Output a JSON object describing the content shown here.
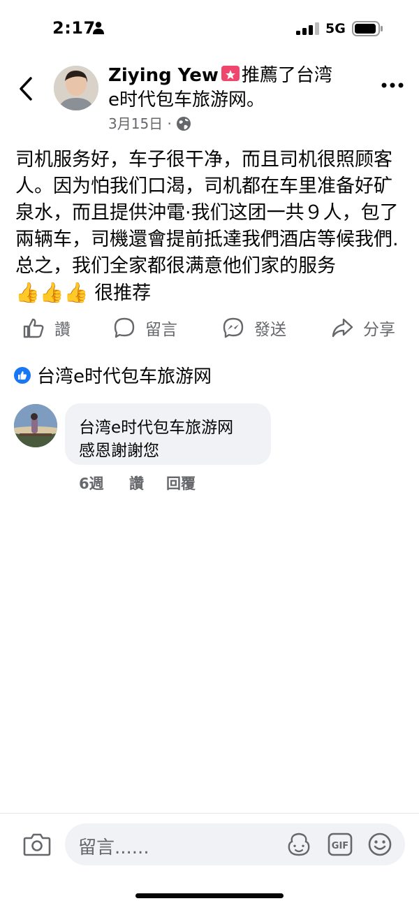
{
  "status_bar": {
    "time": "2:17",
    "network": "5G"
  },
  "header": {
    "author": "Ziying Yew",
    "action_text": "推薦了台湾",
    "page_name_line2": "e时代包车旅游网。",
    "date": "3月15日",
    "separator": "·"
  },
  "post": {
    "body": "司机服务好，车子很干净，而且司机很照顾客人。因为怕我们口渴，司机都在车里准备好矿泉水，而且提供沖電·我们这团一共９人，包了兩辆车，司機還會提前抵達我們酒店等候我們.总之，我们全家都很满意他们家的服务",
    "emojis": "👍👍👍",
    "tail": "很推荐"
  },
  "actions": [
    {
      "label": "讚",
      "icon": "like-icon"
    },
    {
      "label": "留言",
      "icon": "comment-icon"
    },
    {
      "label": "發送",
      "icon": "messenger-icon"
    },
    {
      "label": "分享",
      "icon": "share-icon"
    }
  ],
  "liked_by": "台湾e时代包车旅游网",
  "comment": {
    "author": "台湾e时代包车旅游网",
    "text": "感恩謝謝您",
    "age": "6週",
    "like_label": "讚",
    "reply_label": "回覆"
  },
  "composer": {
    "placeholder": "留言......"
  },
  "colors": {
    "accent": "#1877f2",
    "badge": "#f0466e",
    "muted": "#65676b",
    "bubble": "#f0f2f5"
  }
}
